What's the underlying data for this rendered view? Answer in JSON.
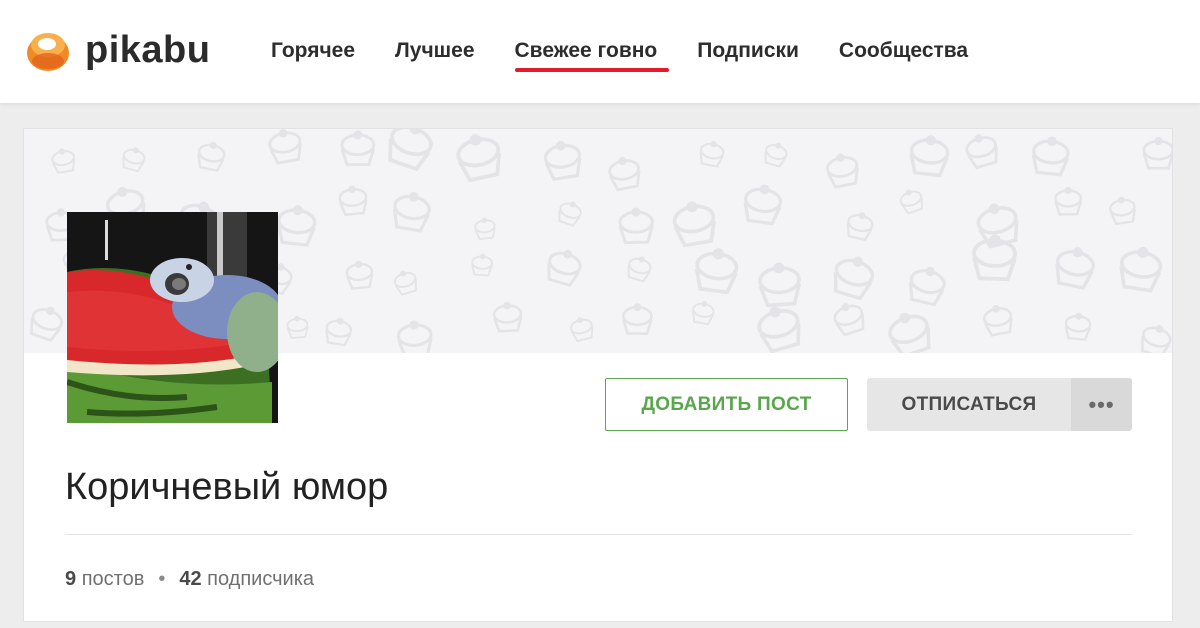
{
  "site": {
    "logo_text": "pikabu",
    "colors": {
      "accent": "#e21c2a",
      "green": "#5aa64d",
      "logo_orange": "#f0902a"
    }
  },
  "nav": {
    "items": [
      {
        "label": "Горячее",
        "active": false
      },
      {
        "label": "Лучшее",
        "active": false
      },
      {
        "label": "Свежее говно",
        "active": true
      },
      {
        "label": "Подписки",
        "active": false
      },
      {
        "label": "Сообщества",
        "active": false
      }
    ]
  },
  "community": {
    "avatar_description_icon": "parrot-on-watermelon-image",
    "name": "Коричневый юмор",
    "add_post_label": "ДОБАВИТЬ ПОСТ",
    "unsubscribe_label": "ОТПИСАТЬСЯ",
    "more_label": "•••",
    "stats": {
      "posts_count": "9",
      "posts_label": "постов",
      "separator": "•",
      "subscribers_count": "42",
      "subscribers_label": "подписчика"
    }
  }
}
